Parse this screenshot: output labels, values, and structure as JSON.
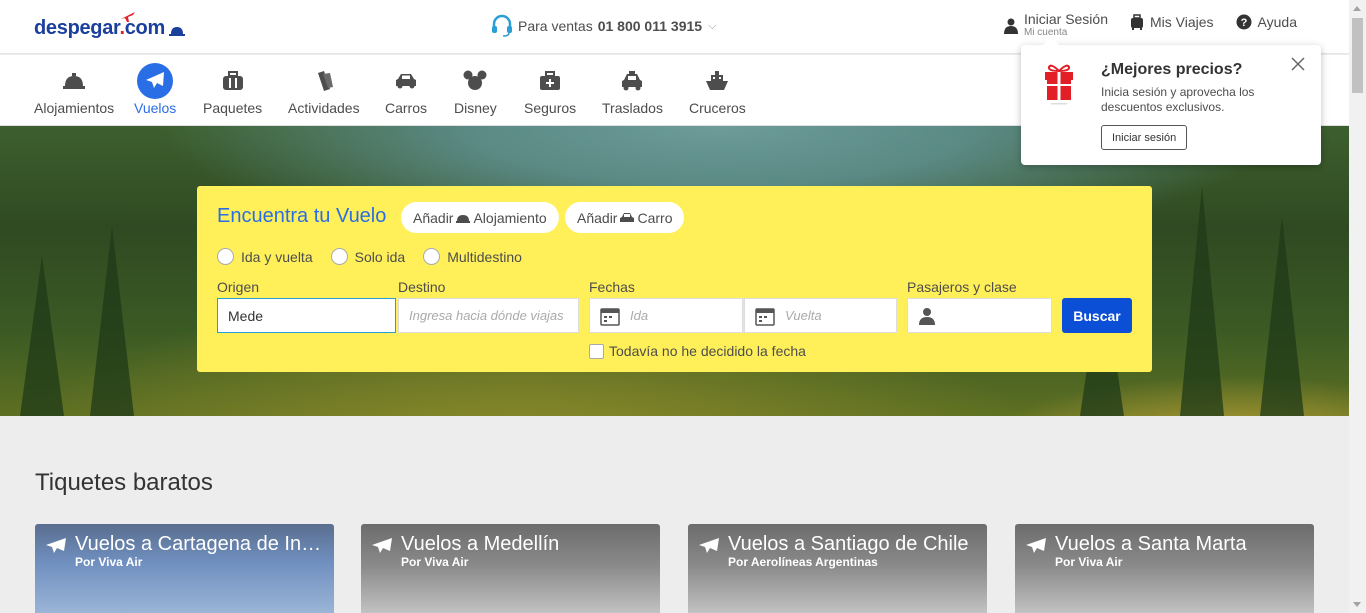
{
  "header": {
    "logo": {
      "name": "despegar",
      "dot": ".",
      "tld": "com"
    },
    "sales": {
      "label": "Para ventas",
      "number": "01 800 011 3915"
    },
    "login": {
      "label": "Iniciar Sesión",
      "sub": "Mi cuenta"
    },
    "trips": "Mis Viajes",
    "help": "Ayuda"
  },
  "products": [
    {
      "label": "Alojamientos",
      "icon": "hotel-bell-icon"
    },
    {
      "label": "Vuelos",
      "icon": "plane-icon",
      "active": true
    },
    {
      "label": "Paquetes",
      "icon": "suitcase-icon"
    },
    {
      "label": "Actividades",
      "icon": "tickets-icon"
    },
    {
      "label": "Carros",
      "icon": "car-icon"
    },
    {
      "label": "Disney",
      "icon": "mickey-icon"
    },
    {
      "label": "Seguros",
      "icon": "medical-kit-icon"
    },
    {
      "label": "Traslados",
      "icon": "taxi-icon"
    },
    {
      "label": "Cruceros",
      "icon": "ship-icon"
    }
  ],
  "search": {
    "title": "Encuentra tu Vuelo",
    "add_hotel": {
      "prefix": "Añadir",
      "label": "Alojamiento"
    },
    "add_car": {
      "prefix": "Añadir",
      "label": "Carro"
    },
    "trip_types": [
      "Ida y vuelta",
      "Solo ida",
      "Multidestino"
    ],
    "origin": {
      "label": "Origen",
      "value": "Mede"
    },
    "destination": {
      "label": "Destino",
      "placeholder": "Ingresa hacia dónde viajas"
    },
    "dates": {
      "label": "Fechas",
      "depart_placeholder": "Ida",
      "return_placeholder": "Vuelta"
    },
    "passengers": {
      "label": "Pasajeros y clase"
    },
    "submit": "Buscar",
    "undecided": "Todavía no he decidido la fecha"
  },
  "popup": {
    "title": "¿Mejores precios?",
    "description": "Inicia sesión y aprovecha los descuentos exclusivos.",
    "button": "Iniciar sesión"
  },
  "deals": {
    "title": "Tiquetes baratos",
    "cards": [
      {
        "title": "Vuelos a Cartagena de Indias",
        "carrier": "Por Viva Air"
      },
      {
        "title": "Vuelos a Medellín",
        "carrier": "Por Viva Air"
      },
      {
        "title": "Vuelos a Santiago de Chile",
        "carrier": "Por Aerolíneas Argentinas"
      },
      {
        "title": "Vuelos a Santa Marta",
        "carrier": "Por Viva Air"
      }
    ]
  },
  "colors": {
    "brand": "#1b3f9d",
    "accent": "#2a6ee5",
    "search_bg": "#fff059",
    "search_button": "#0b4fd6",
    "gift_red": "#e21f26"
  }
}
